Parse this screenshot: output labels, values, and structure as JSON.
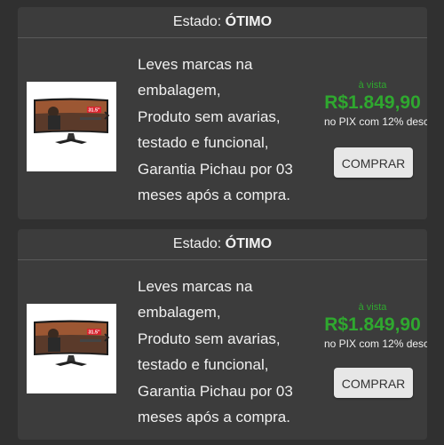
{
  "listings": [
    {
      "condition_label": "Estado:",
      "condition_value": "ÓTIMO",
      "monitor_size_badge": "31.5\"",
      "description": [
        "Leves marcas na",
        "embalagem,",
        "Produto sem avarias,",
        "testado e funcional,",
        "Garantia Pichau por 03",
        "meses após a compra."
      ],
      "price_caption": "à vista",
      "price": "R$1.849,90",
      "payment_note": "no PIX com 12% desc",
      "buy_label": "COMPRAR"
    },
    {
      "condition_label": "Estado:",
      "condition_value": "ÓTIMO",
      "monitor_size_badge": "31.5\"",
      "description": [
        "Leves marcas na",
        "embalagem,",
        "Produto sem avarias,",
        "testado e funcional,",
        "Garantia Pichau por 03",
        "meses após a compra."
      ],
      "price_caption": "à vista",
      "price": "R$1.849,90",
      "payment_note": "no PIX com 12% desc",
      "buy_label": "COMPRAR"
    }
  ],
  "colors": {
    "page_background": "#303030",
    "card_background": "#3c3c3c",
    "price_green": "#2fa82f",
    "button_background": "#e7e7e7",
    "badge_red": "#d9232d"
  },
  "icons": [
    "monitor-product-image",
    "chevron-right-icon"
  ]
}
